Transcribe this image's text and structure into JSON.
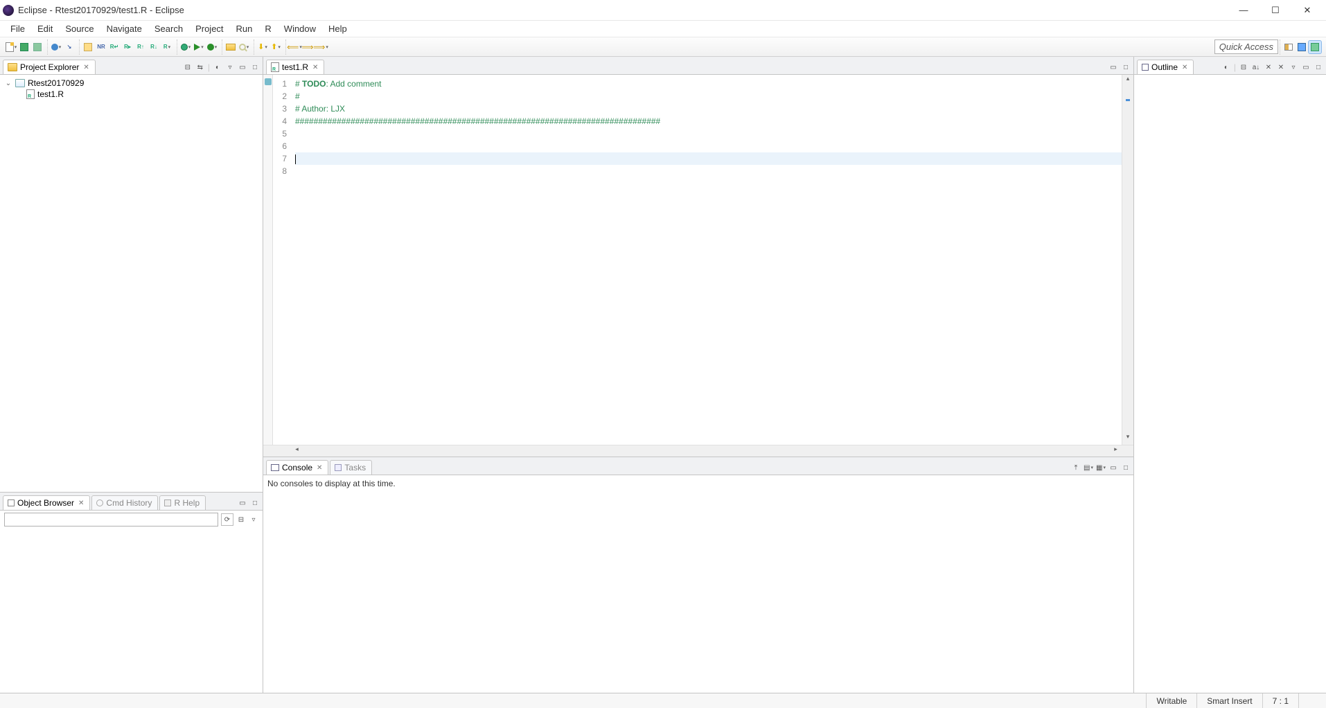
{
  "titlebar": {
    "title": "Eclipse - Rtest20170929/test1.R - Eclipse"
  },
  "menubar": {
    "items": [
      "File",
      "Edit",
      "Source",
      "Navigate",
      "Search",
      "Project",
      "Run",
      "R",
      "Window",
      "Help"
    ]
  },
  "toolbar": {
    "quick_access": "Quick Access"
  },
  "project_explorer": {
    "title": "Project Explorer",
    "project_name": "Rtest20170929",
    "file_name": "test1.R"
  },
  "editor": {
    "tab_label": "test1.R",
    "lines": [
      {
        "n": 1,
        "segments": [
          {
            "t": "# ",
            "cls": "c-comment"
          },
          {
            "t": "TODO",
            "cls": "c-keyword"
          },
          {
            "t": ": Add comment",
            "cls": "c-comment"
          }
        ]
      },
      {
        "n": 2,
        "segments": [
          {
            "t": "# ",
            "cls": "c-comment"
          }
        ]
      },
      {
        "n": 3,
        "segments": [
          {
            "t": "# Author: LJX",
            "cls": "c-comment"
          }
        ]
      },
      {
        "n": 4,
        "segments": [
          {
            "t": "###############################################################################",
            "cls": "c-comment"
          }
        ]
      },
      {
        "n": 5,
        "segments": []
      },
      {
        "n": 6,
        "segments": []
      },
      {
        "n": 7,
        "segments": [],
        "current": true,
        "cursor": true
      },
      {
        "n": 8,
        "segments": []
      }
    ]
  },
  "console": {
    "tab_console": "Console",
    "tab_tasks": "Tasks",
    "message": "No consoles to display at this time."
  },
  "object_browser": {
    "tab_obj": "Object Browser",
    "tab_cmd": "Cmd History",
    "tab_rhelp": "R Help"
  },
  "outline": {
    "title": "Outline"
  },
  "statusbar": {
    "writable": "Writable",
    "insert_mode": "Smart Insert",
    "position": "7 : 1"
  }
}
